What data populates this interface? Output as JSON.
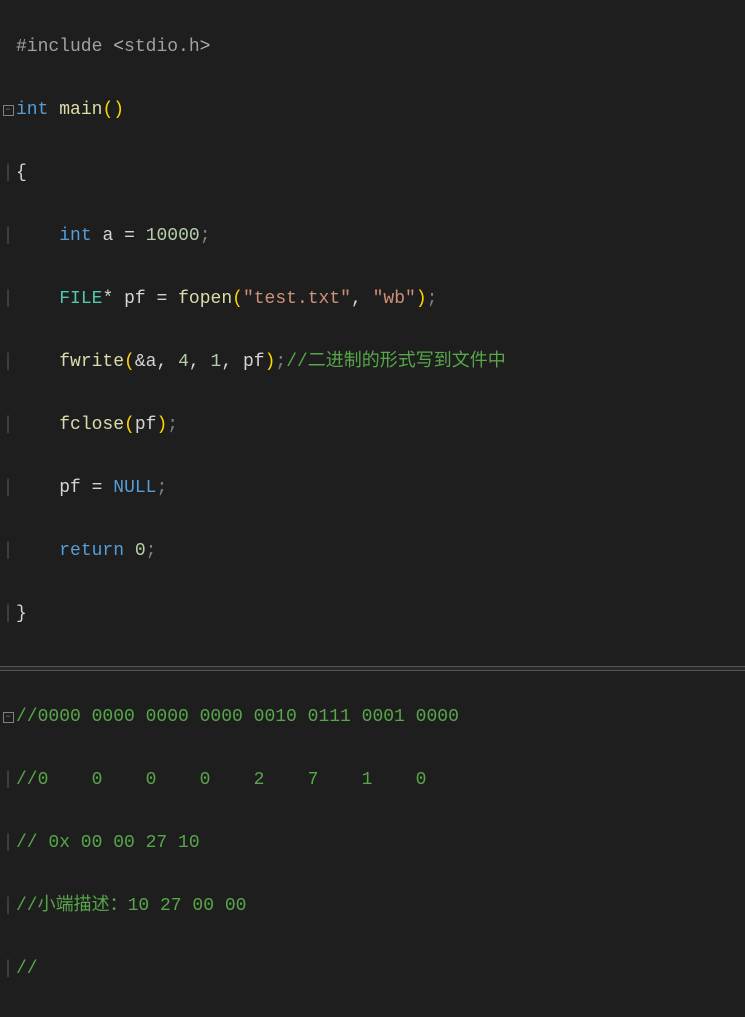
{
  "code": {
    "l1": {
      "preproc": "#include",
      "open": "<",
      "header": "stdio.h",
      "close": ">"
    },
    "l2": {
      "kw": "int",
      "fn": "main",
      "paren": "()"
    },
    "l3": {
      "brace": "{"
    },
    "l4": {
      "kw": "int",
      "id": "a",
      "op": "=",
      "num": "10000",
      "semi": ";"
    },
    "l5": {
      "type": "FILE",
      "star": "*",
      "id": "pf",
      "op": "=",
      "fn": "fopen",
      "po": "(",
      "s1": "\"test.txt\"",
      "comma": ",",
      "s2": "\"wb\"",
      "pc": ")",
      "semi": ";"
    },
    "l6": {
      "fn": "fwrite",
      "po": "(",
      "amp": "&",
      "a": "a",
      "c1": ",",
      "n1": "4",
      "c2": ",",
      "n2": "1",
      "c3": ",",
      "pf": "pf",
      "pc": ")",
      "semi": ";",
      "cmt": "//二进制的形式写到文件中"
    },
    "l7": {
      "fn": "fclose",
      "po": "(",
      "pf": "pf",
      "pc": ")",
      "semi": ";"
    },
    "l8": {
      "id": "pf",
      "op": "=",
      "null": "NULL",
      "semi": ";"
    },
    "l9": {
      "kw": "return",
      "num": "0",
      "semi": ";"
    },
    "l10": {
      "brace": "}"
    },
    "c1": "//0000 0000 0000 0000 0010 0111 0001 0000",
    "c2": "//0    0    0    0    2    7    1    0",
    "c3": "// 0x 00 00 27 10",
    "c4": "//小端描述：10 27 00 00",
    "c5": "//"
  }
}
